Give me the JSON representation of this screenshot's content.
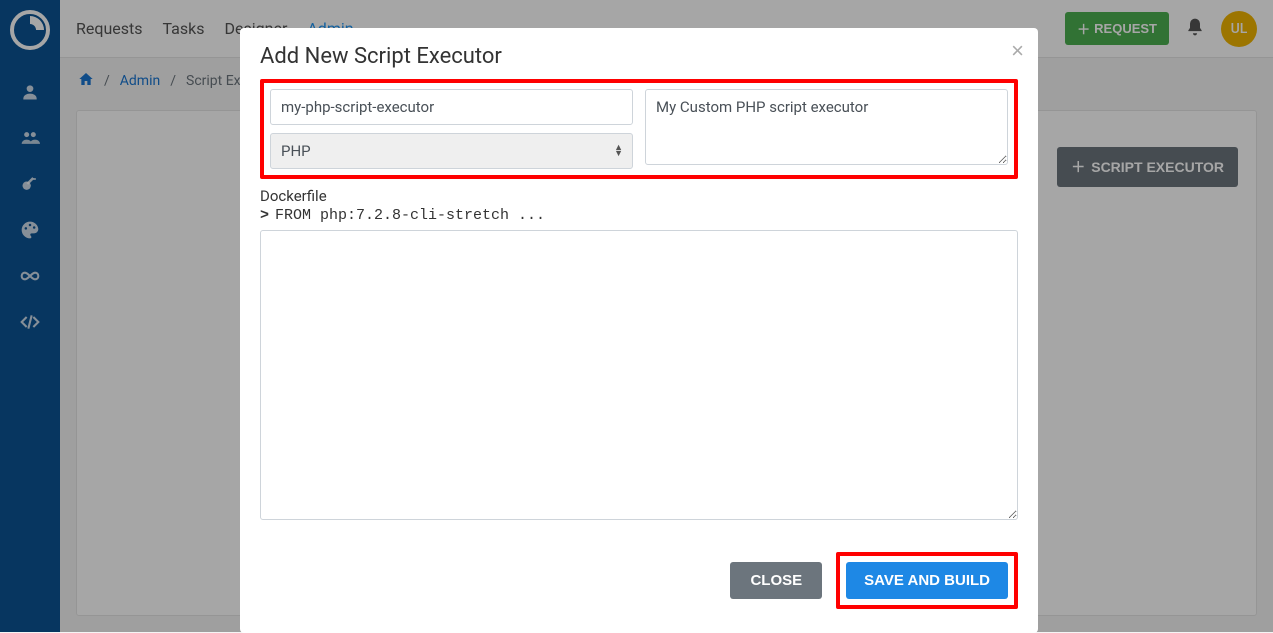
{
  "topnav": {
    "items": [
      "Requests",
      "Tasks",
      "Designer",
      "Admin"
    ]
  },
  "topright": {
    "request_btn": "REQUEST",
    "avatar_initials": "UL"
  },
  "breadcrumb": {
    "admin": "Admin",
    "current": "Script Executors"
  },
  "content": {
    "script_executor_btn": "SCRIPT EXECUTOR"
  },
  "modal": {
    "title": "Add New Script Executor",
    "name_value": "my-php-script-executor",
    "language_value": "PHP",
    "description_value": "My Custom PHP script executor",
    "dockerfile_label": "Dockerfile",
    "dockerfile_preview": "FROM php:7.2.8-cli-stretch ...",
    "config_value": "",
    "close_btn": "CLOSE",
    "save_btn": "SAVE AND BUILD"
  }
}
